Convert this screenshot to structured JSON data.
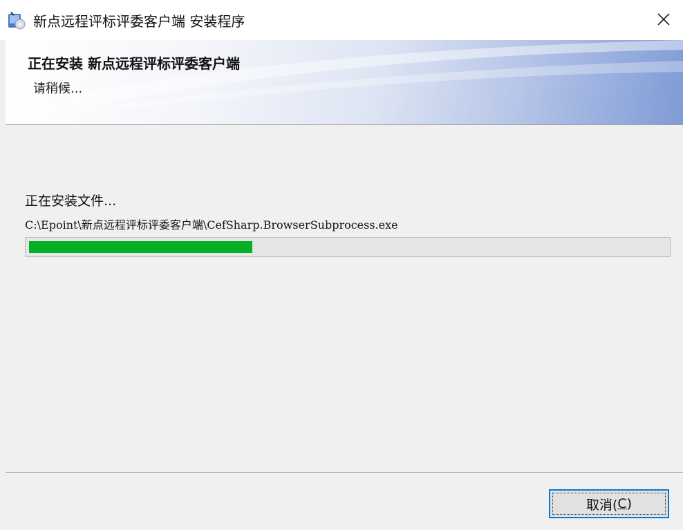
{
  "window": {
    "title": "新点远程评标评委客户端 安装程序",
    "icon": "installer-icon",
    "close_icon": "close-icon"
  },
  "banner": {
    "title": "正在安装 新点远程评标评委客户端",
    "subtitle": "请稍候..."
  },
  "install": {
    "status_label": "正在安装文件...",
    "current_file": "C:\\Epoint\\新点远程评标评委客户端\\CefSharp.BrowserSubprocess.exe",
    "progress": 0.35,
    "progress_color": "#06b025"
  },
  "footer": {
    "cancel_label_prefix": "取消(",
    "cancel_hotkey": "C",
    "cancel_label_suffix": ")"
  }
}
